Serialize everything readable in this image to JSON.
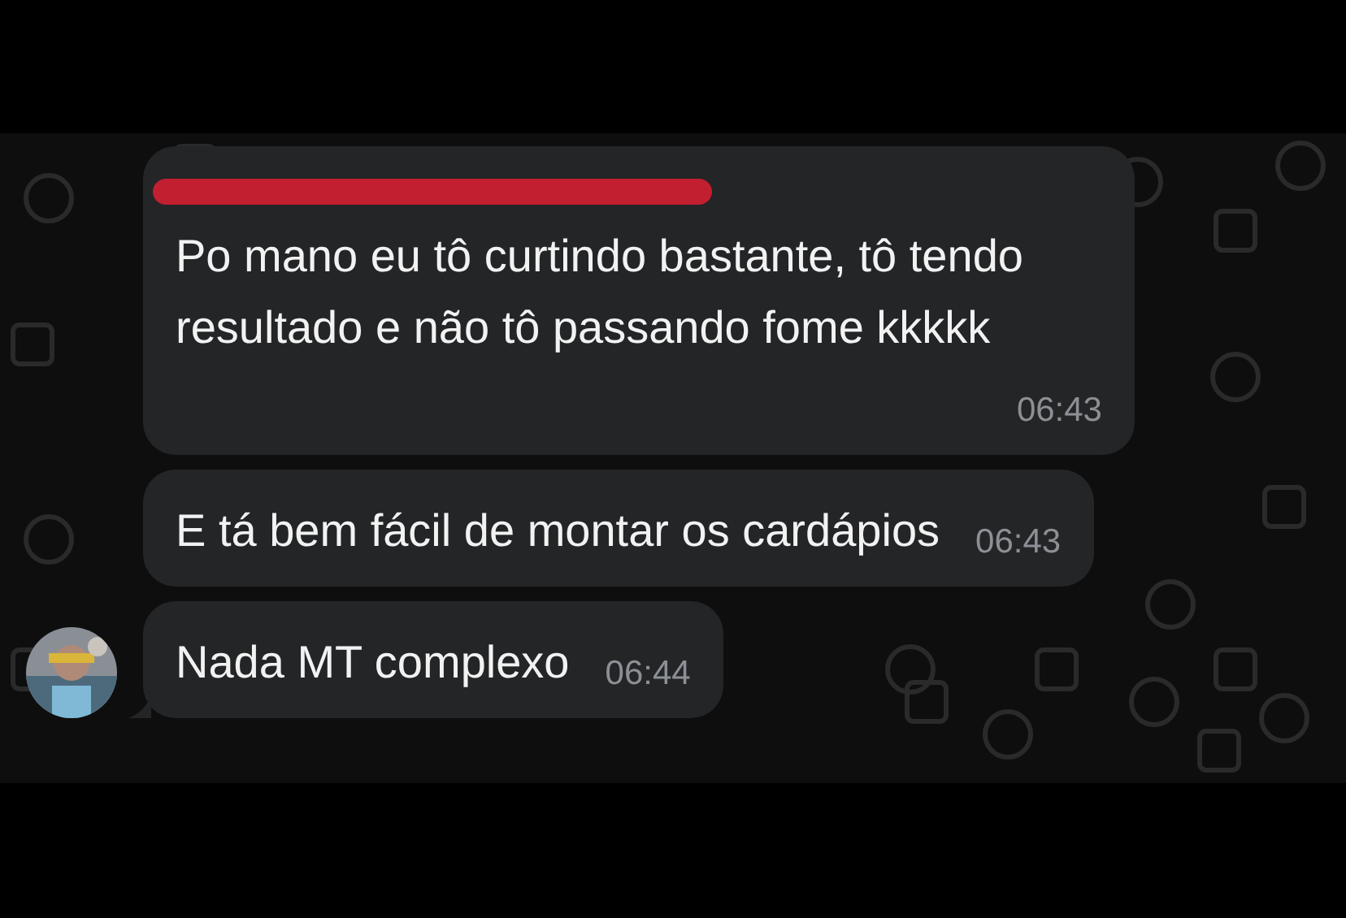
{
  "messages": [
    {
      "kind": "redacted_sender",
      "text": "Po mano eu tô curtindo bastante, tô tendo resultado e não tô passando fome kkkkk",
      "time": "06:43"
    },
    {
      "kind": "plain",
      "text": "E tá bem fácil de montar os cardápios",
      "time": "06:43"
    },
    {
      "kind": "with_avatar",
      "text": "Nada MT complexo",
      "time": "06:44"
    }
  ]
}
